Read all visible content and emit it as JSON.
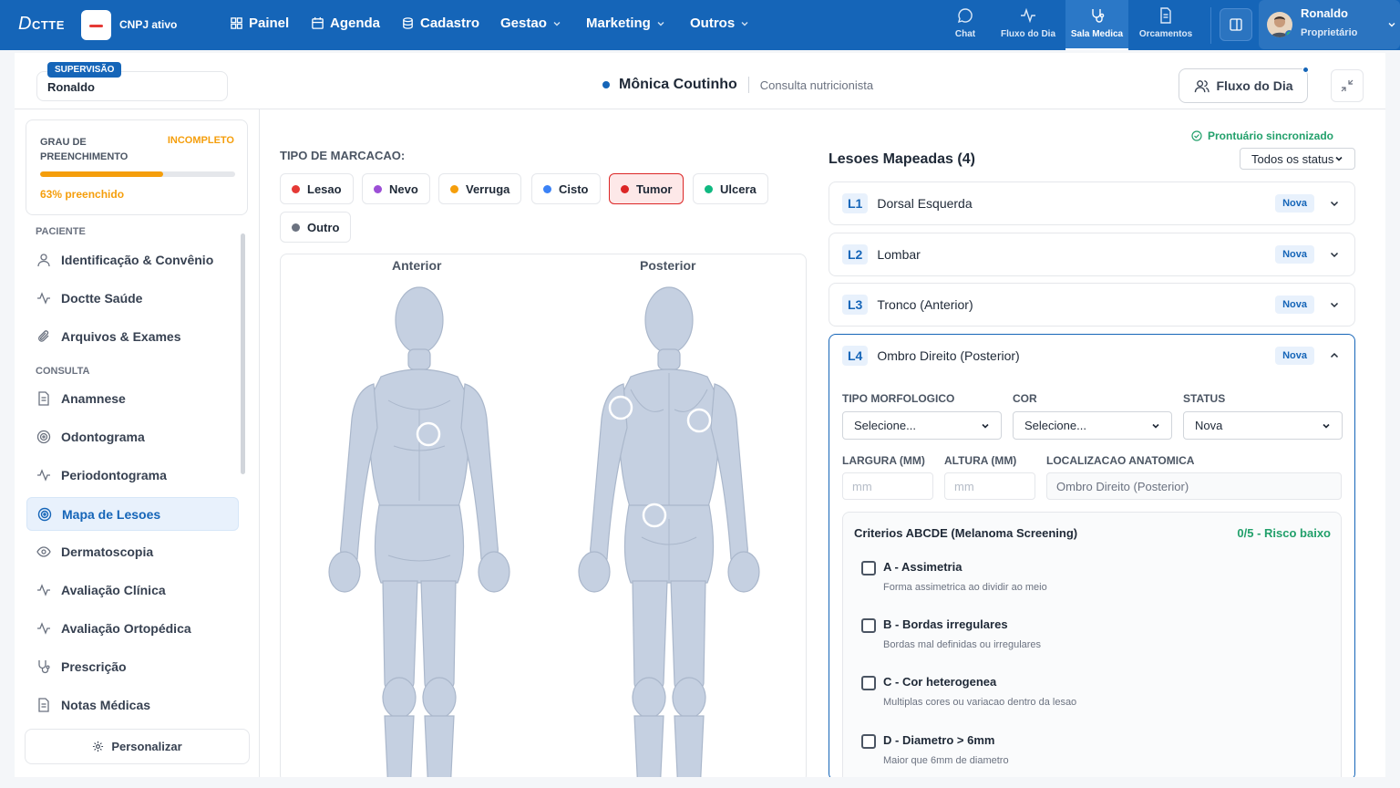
{
  "topbar": {
    "logo": "Docтте",
    "logo_main": "D",
    "logo_rest": "CTTE",
    "cnpj": "CNPJ ativo",
    "nav": [
      "Painel",
      "Agenda",
      "Cadastro",
      "Gestao",
      "Marketing",
      "Outros"
    ],
    "tools": [
      "Chat",
      "Fluxo do Dia",
      "Sala Medica",
      "Orcamentos"
    ],
    "active_tool": "Sala Medica",
    "user_name": "Ronaldo",
    "user_role": "Proprietário"
  },
  "subheader": {
    "badge": "SUPERVISÃO",
    "supervisor": "Ronaldo",
    "patient_name": "Mônica Coutinho",
    "consult_type": "Consulta nutricionista",
    "fluxo_button": "Fluxo do Dia"
  },
  "sidebar": {
    "progress_title": "GRAU DE PREENCHIMENTO",
    "progress_status": "INCOMPLETO",
    "progress_value": 0.63,
    "progress_text": "63% preenchido",
    "section_patient": "PACIENTE",
    "patient_items": [
      "Identificação & Convênio",
      "Doctte Saúde",
      "Arquivos & Exames"
    ],
    "section_consult": "CONSULTA",
    "consult_items": [
      "Anamnese",
      "Odontograma",
      "Periodontograma",
      "Mapa de Lesoes",
      "Dermatoscopia",
      "Avaliação Clínica",
      "Avaliação Ortopédica",
      "Prescrição",
      "Notas Médicas"
    ],
    "active_item": "Mapa de Lesoes",
    "customize": "Personalizar"
  },
  "main": {
    "tipo_label": "TIPO DE MARCACAO:",
    "marker_types": [
      {
        "label": "Lesao",
        "color": "#e53935"
      },
      {
        "label": "Nevo",
        "color": "#9c4fd6"
      },
      {
        "label": "Verruga",
        "color": "#f59e0b"
      },
      {
        "label": "Cisto",
        "color": "#3b82f6"
      },
      {
        "label": "Tumor",
        "color": "#dc2626"
      },
      {
        "label": "Ulcera",
        "color": "#10b981"
      },
      {
        "label": "Outro",
        "color": "#6b7280"
      }
    ],
    "selected_marker": "Tumor",
    "view_anterior": "Anterior",
    "view_posterior": "Posterior"
  },
  "lesions_panel": {
    "sync": "Prontuário sincronizado",
    "title": "Lesoes Mapeadas (4)",
    "filter": "Todos os status",
    "lesions": [
      {
        "code": "L1",
        "name": "Dorsal Esquerda",
        "status": "Nova"
      },
      {
        "code": "L2",
        "name": "Lombar",
        "status": "Nova"
      },
      {
        "code": "L3",
        "name": "Tronco (Anterior)",
        "status": "Nova"
      },
      {
        "code": "L4",
        "name": "Ombro Direito (Posterior)",
        "status": "Nova"
      }
    ],
    "form": {
      "tipo_label": "TIPO MORFOLOGICO",
      "tipo_value": "Selecione...",
      "cor_label": "COR",
      "cor_value": "Selecione...",
      "status_label": "STATUS",
      "status_value": "Nova",
      "largura_label": "LARGURA (MM)",
      "largura_placeholder": "mm",
      "altura_label": "ALTURA (MM)",
      "altura_placeholder": "mm",
      "local_label": "LOCALIZACAO ANATOMICA",
      "local_value": "Ombro Direito (Posterior)"
    },
    "abcde": {
      "title": "Criterios ABCDE (Melanoma Screening)",
      "score": "0/5 - Risco baixo",
      "criteria": [
        {
          "name": "A - Assimetria",
          "desc": "Forma assimetrica ao dividir ao meio"
        },
        {
          "name": "B - Bordas irregulares",
          "desc": "Bordas mal definidas ou irregulares"
        },
        {
          "name": "C - Cor heterogenea",
          "desc": "Multiplas cores ou variacao dentro da lesao"
        },
        {
          "name": "D - Diametro > 6mm",
          "desc": "Maior que 6mm de diametro"
        }
      ]
    }
  },
  "colors": {
    "primary": "#1565b8",
    "warning": "#f59e0b",
    "success": "#22a06b",
    "body": "#c5d0e1"
  }
}
